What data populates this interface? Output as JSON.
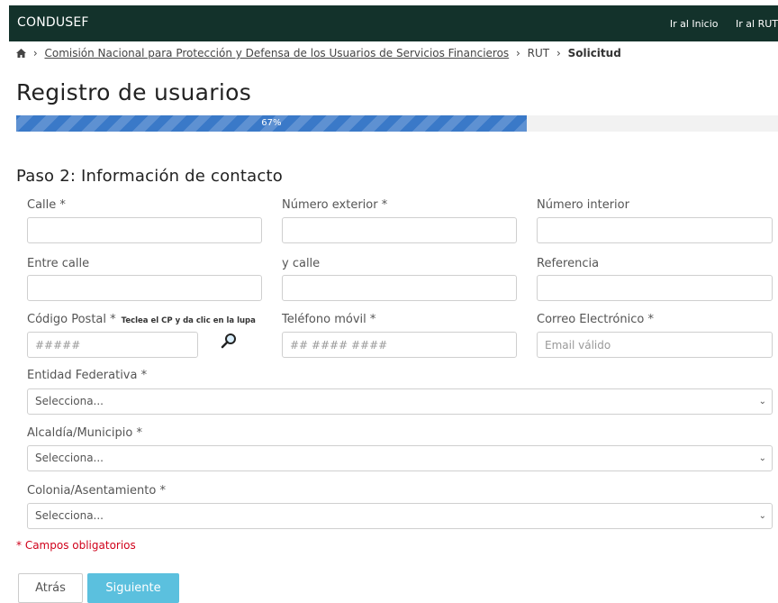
{
  "header": {
    "brand": "CONDUSEF",
    "links": [
      "Ir al Inicio",
      "Ir al RUT"
    ]
  },
  "breadcrumb": {
    "org": "Comisión Nacional para Protección y Defensa de los Usuarios de Servicios Financieros",
    "section": "RUT",
    "current": "Solicitud"
  },
  "page": {
    "title": "Registro de usuarios",
    "progress_label": "67%",
    "progress_value": 67,
    "step_title": "Paso 2: Información de contacto"
  },
  "form": {
    "calle": {
      "label": "Calle *",
      "value": ""
    },
    "num_ext": {
      "label": "Número exterior *",
      "value": ""
    },
    "num_int": {
      "label": "Número interior",
      "value": ""
    },
    "entre_calle": {
      "label": "Entre calle",
      "value": ""
    },
    "y_calle": {
      "label": "y calle",
      "value": ""
    },
    "referencia": {
      "label": "Referencia",
      "value": ""
    },
    "cp": {
      "label": "Código Postal *",
      "hint": "Teclea el CP y da clic en la lupa",
      "placeholder": "#####",
      "value": ""
    },
    "telefono": {
      "label": "Teléfono móvil *",
      "placeholder": "## #### ####",
      "value": ""
    },
    "correo": {
      "label": "Correo Electrónico *",
      "placeholder": "Email válido",
      "value": ""
    },
    "entidad": {
      "label": "Entidad Federativa *",
      "selected": "Selecciona..."
    },
    "alcaldia": {
      "label": "Alcaldía/Municipio *",
      "selected": "Selecciona..."
    },
    "colonia": {
      "label": "Colonia/Asentamiento *",
      "selected": "Selecciona..."
    }
  },
  "required_note": "* Campos obligatorios",
  "buttons": {
    "back": "Atrás",
    "next": "Siguiente"
  },
  "colors": {
    "header_bg": "#13322b",
    "progress": "#3a79c8",
    "primary_button": "#5bc0de",
    "required": "#d0021b"
  }
}
